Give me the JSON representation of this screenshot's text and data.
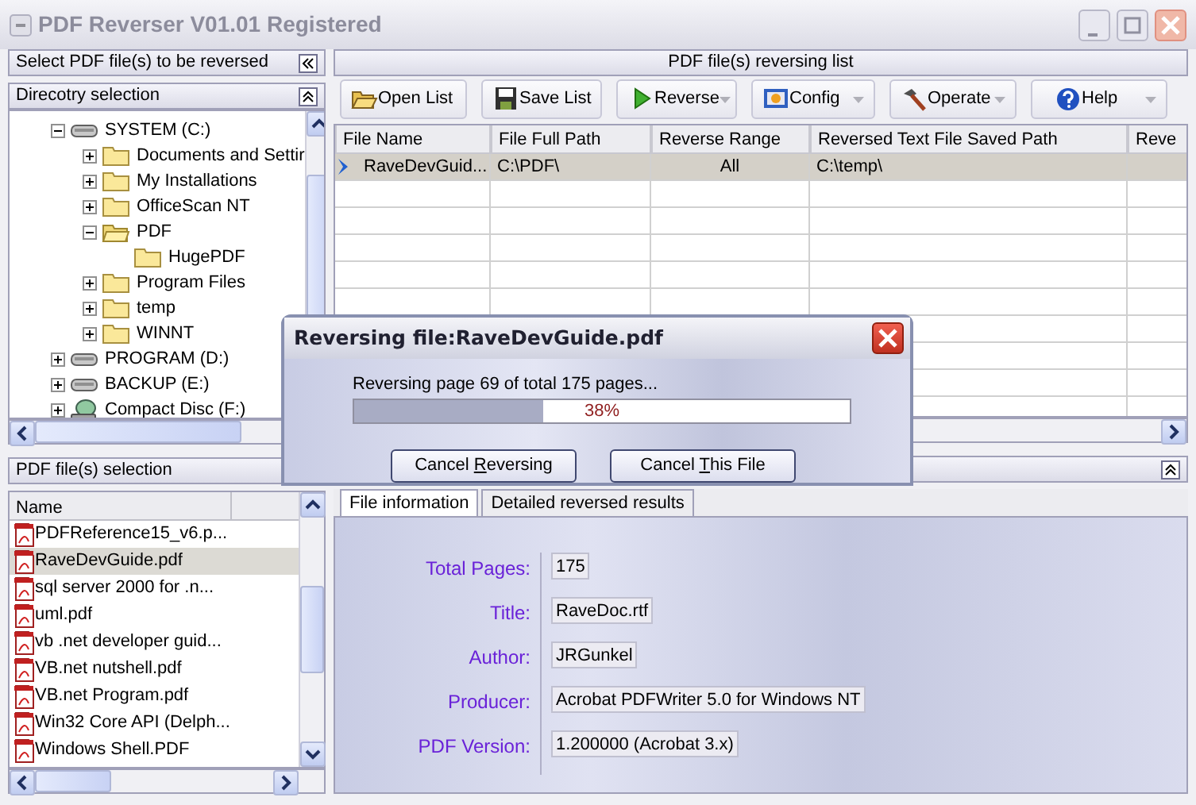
{
  "window": {
    "title": "PDF Reverser V01.01 Registered"
  },
  "left_panel": {
    "title": "Select PDF file(s) to be reversed",
    "directory": {
      "title": "Direcotry selection",
      "tree": [
        {
          "label": "SYSTEM (C:)",
          "kind": "drive",
          "expanded": true,
          "children": [
            {
              "label": "Documents and Settir",
              "kind": "folder",
              "expanded": false
            },
            {
              "label": "My Installations",
              "kind": "folder",
              "expanded": false
            },
            {
              "label": "OfficeScan NT",
              "kind": "folder",
              "expanded": false
            },
            {
              "label": "PDF",
              "kind": "folder",
              "expanded": true,
              "children": [
                {
                  "label": "HugePDF",
                  "kind": "folder"
                }
              ]
            },
            {
              "label": "Program Files",
              "kind": "folder",
              "expanded": false
            },
            {
              "label": "temp",
              "kind": "folder",
              "expanded": false
            },
            {
              "label": "WINNT",
              "kind": "folder",
              "expanded": false
            }
          ]
        },
        {
          "label": "PROGRAM (D:)",
          "kind": "drive",
          "expanded": false
        },
        {
          "label": "BACKUP (E:)",
          "kind": "drive",
          "expanded": false
        },
        {
          "label": "Compact Disc (F:)",
          "kind": "cdrom",
          "expanded": false
        }
      ]
    },
    "file_selection": {
      "title": "PDF file(s) selection",
      "columns": [
        "Name"
      ],
      "files": [
        {
          "name": "PDFReference15_v6.p...",
          "selected": false
        },
        {
          "name": "RaveDevGuide.pdf",
          "selected": true
        },
        {
          "name": "sql server 2000 for .n...",
          "selected": false
        },
        {
          "name": "uml.pdf",
          "selected": false
        },
        {
          "name": "vb .net developer guid...",
          "selected": false
        },
        {
          "name": "VB.net nutshell.pdf",
          "selected": false
        },
        {
          "name": "VB.net Program.pdf",
          "selected": false
        },
        {
          "name": "Win32 Core API (Delph...",
          "selected": false
        },
        {
          "name": "Windows Shell.PDF",
          "selected": false
        }
      ]
    }
  },
  "reversing_list": {
    "title": "PDF file(s) reversing list",
    "toolbar": [
      {
        "label": "Open List",
        "kind": "open",
        "dropdown": false
      },
      {
        "label": "Save List",
        "kind": "save",
        "dropdown": false
      },
      {
        "label": "Reverse",
        "kind": "play",
        "dropdown": true
      },
      {
        "label": "Config",
        "kind": "config",
        "dropdown": true
      },
      {
        "label": "Operate",
        "kind": "hammer",
        "dropdown": true
      },
      {
        "label": "Help",
        "kind": "help",
        "dropdown": true
      }
    ],
    "columns": [
      "File Name",
      "File Full Path",
      "Reverse Range",
      "Reversed Text File Saved Path",
      "Reve"
    ],
    "rows": [
      {
        "cells": [
          "RaveDevGuid...",
          "C:\\PDF\\",
          "All",
          "C:\\temp\\"
        ],
        "selected": true
      }
    ]
  },
  "file_details": {
    "tabs": [
      {
        "label": "File information",
        "selected": true
      },
      {
        "label": "Detailed reversed results",
        "selected": false
      }
    ],
    "fields": [
      {
        "label": "Total Pages:",
        "value": "175"
      },
      {
        "label": "Title:",
        "value": "RaveDoc.rtf"
      },
      {
        "label": "Author:",
        "value": "JRGunkel"
      },
      {
        "label": "Producer:",
        "value": "Acrobat PDFWriter 5.0 for Windows NT"
      },
      {
        "label": "PDF Version:",
        "value": "1.200000 (Acrobat 3.x)"
      }
    ]
  },
  "dialog": {
    "title": "Reversing file:RaveDevGuide.pdf",
    "message": "Reversing page 69 of total 175 pages...",
    "level": 0.38,
    "percent": "38%",
    "buttons": [
      {
        "before": "Cancel ",
        "key": "R",
        "after": "eversing"
      },
      {
        "before": "Cancel ",
        "key": "T",
        "after": "his File"
      }
    ]
  }
}
